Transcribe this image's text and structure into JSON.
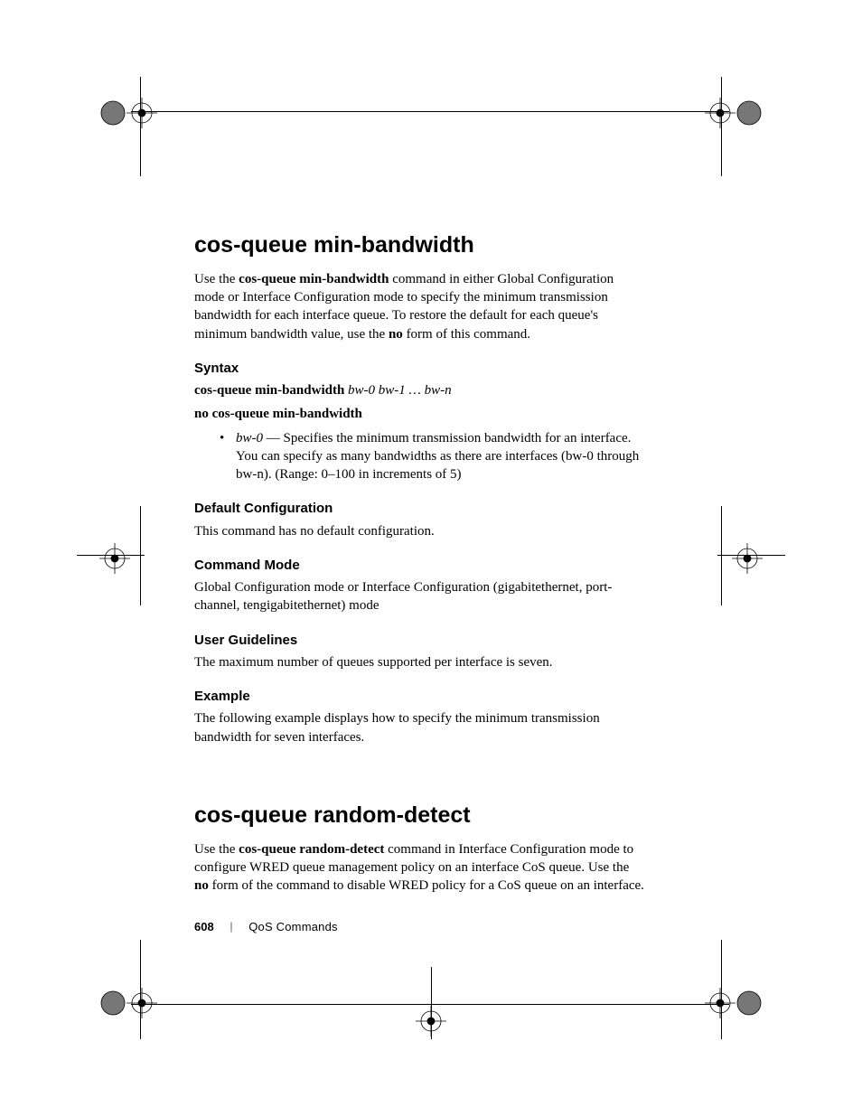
{
  "section1": {
    "title": "cos-queue min-bandwidth",
    "intro_pre": "Use the ",
    "intro_bold": "cos-queue min-bandwidth",
    "intro_mid": " command in either Global Configuration mode or Interface Configuration mode to specify the minimum transmission bandwidth for each interface queue. To restore the default for each queue's minimum bandwidth value, use the ",
    "intro_no": "no",
    "intro_post": " form of this command.",
    "syntax_heading": "Syntax",
    "syntax_cmd_bold": "cos-queue min-bandwidth",
    "syntax_cmd_args": " bw-0 bw-1 … bw-n",
    "syntax_no": "no cos-queue min-bandwidth",
    "bullet_arg": "bw-0",
    "bullet_text": " — Specifies the minimum transmission bandwidth for an interface. You can specify as many bandwidths as there are interfaces (bw-0 through bw-n). (Range: 0–100 in increments of 5)",
    "default_heading": "Default Configuration",
    "default_text": "This command has no default configuration.",
    "mode_heading": "Command Mode",
    "mode_text": "Global Configuration mode or Interface Configuration (gigabitethernet, port-channel, tengigabitethernet) mode",
    "guidelines_heading": "User Guidelines",
    "guidelines_text": "The maximum number of queues supported per interface is seven.",
    "example_heading": "Example",
    "example_text": "The following example displays how to specify the minimum transmission bandwidth for seven interfaces."
  },
  "section2": {
    "title": "cos-queue random-detect",
    "intro_pre": "Use the ",
    "intro_bold": "cos-queue random-detect",
    "intro_mid": " command in Interface Configuration mode to configure WRED queue management policy on an interface CoS queue. Use the ",
    "intro_no": "no",
    "intro_post": " form of the command to disable WRED policy for a CoS queue on an interface."
  },
  "footer": {
    "page_number": "608",
    "separator": "|",
    "chapter": "QoS Commands"
  }
}
